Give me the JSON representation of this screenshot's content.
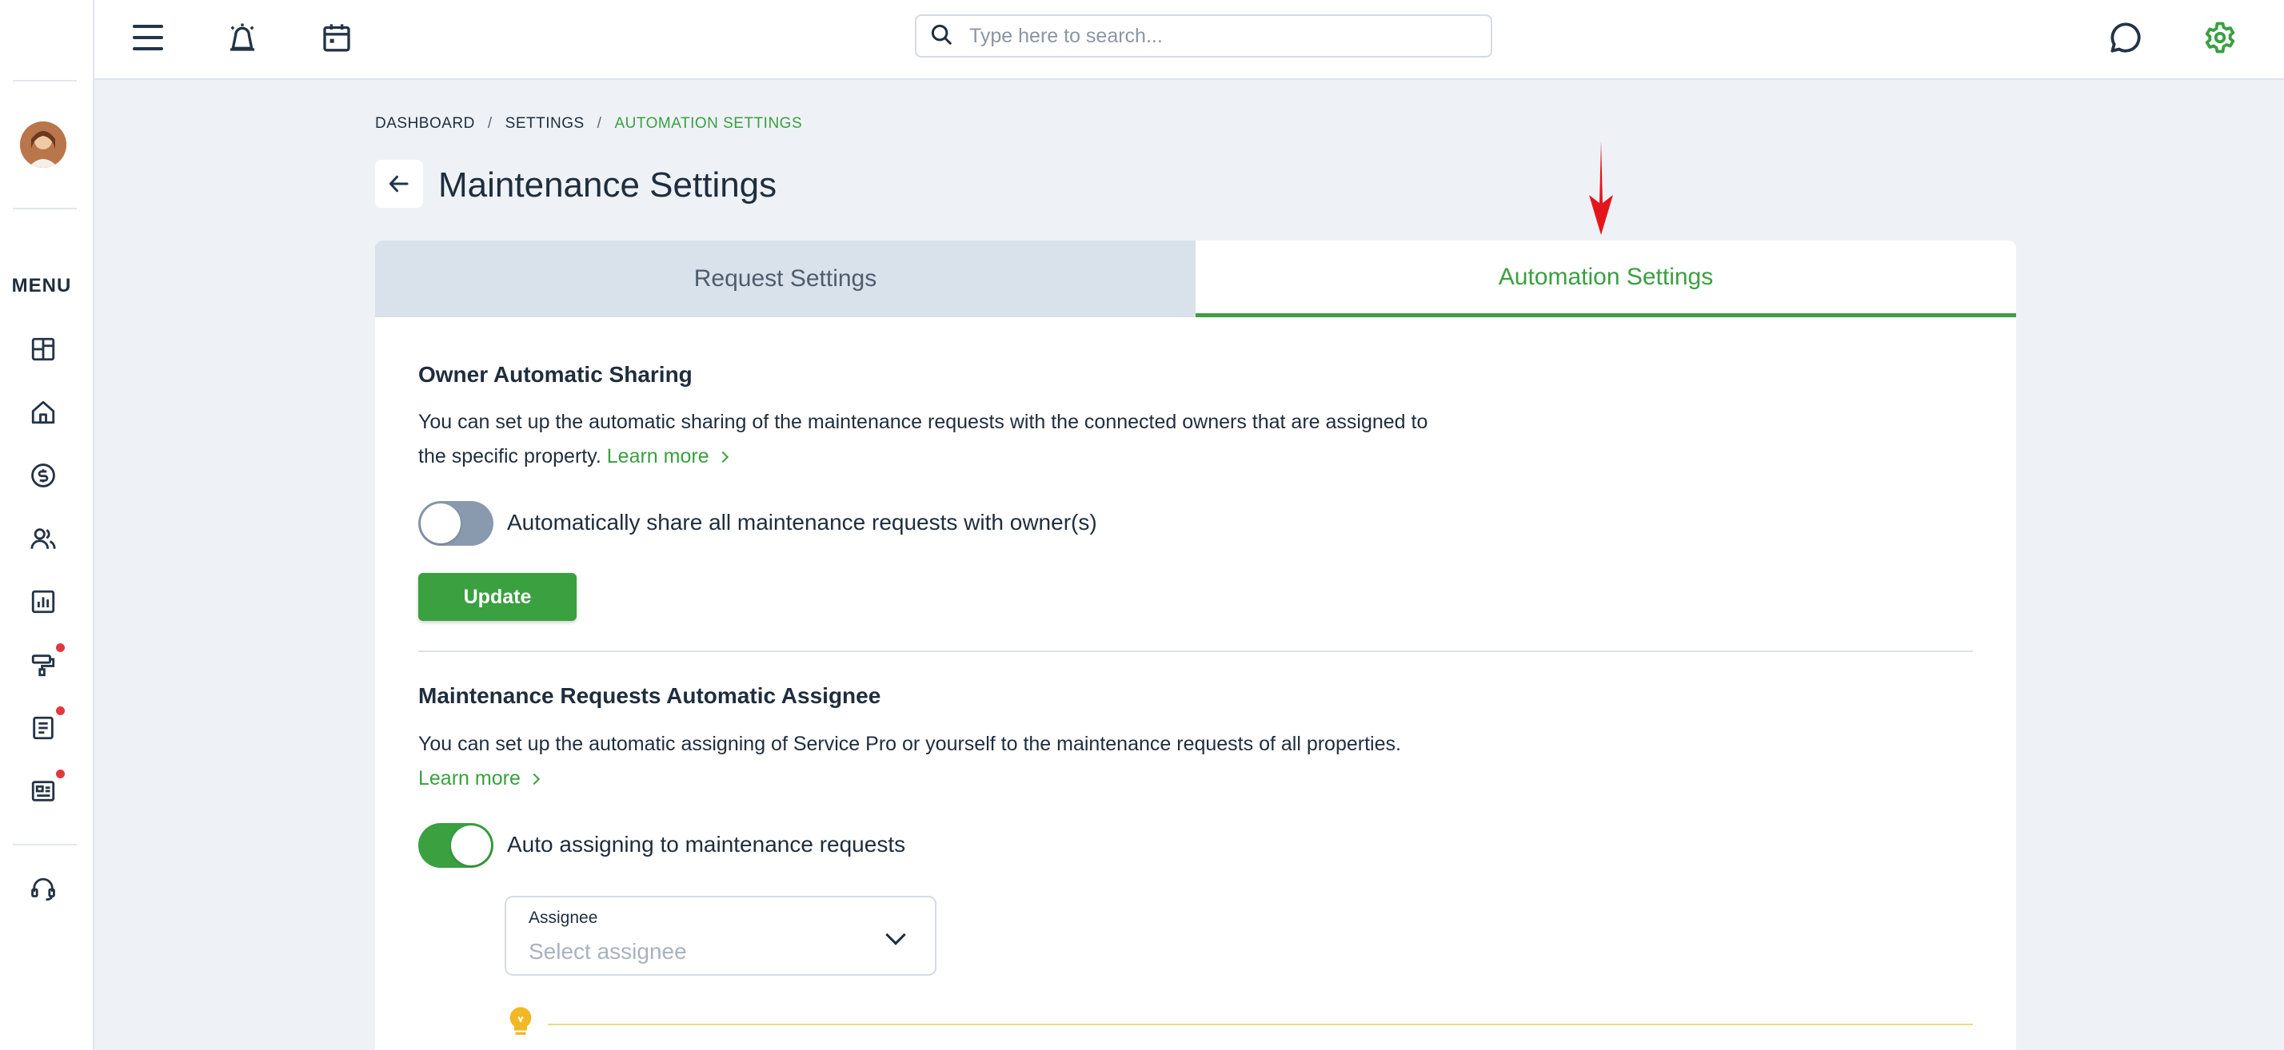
{
  "search": {
    "placeholder": "Type here to search..."
  },
  "sidebar": {
    "menu_label": "MENU",
    "items": [
      {
        "icon": "dashboard-icon",
        "badge": false
      },
      {
        "icon": "home-icon",
        "badge": false
      },
      {
        "icon": "dollar-icon",
        "badge": false
      },
      {
        "icon": "people-icon",
        "badge": false
      },
      {
        "icon": "reports-icon",
        "badge": false
      },
      {
        "icon": "maintenance-icon",
        "badge": true
      },
      {
        "icon": "document-icon",
        "badge": true
      },
      {
        "icon": "listing-icon",
        "badge": true
      },
      {
        "icon": "support-icon",
        "badge": false
      }
    ]
  },
  "breadcrumb": {
    "items": [
      "DASHBOARD",
      "SETTINGS"
    ],
    "current": "AUTOMATION SETTINGS",
    "separator": "/"
  },
  "page": {
    "title": "Maintenance Settings"
  },
  "tabs": [
    {
      "label": "Request Settings",
      "active": false
    },
    {
      "label": "Automation Settings",
      "active": true
    }
  ],
  "owner_sharing": {
    "title": "Owner Automatic Sharing",
    "desc_line1": "You can set up the automatic sharing of the maintenance requests with the connected owners that are assigned to",
    "desc_line2": "the specific property.",
    "learn_more": "Learn more",
    "toggle_label": "Automatically share all maintenance requests with owner(s)",
    "toggle_on": false,
    "update_label": "Update"
  },
  "auto_assignee": {
    "title": "Maintenance Requests Automatic Assignee",
    "desc": "You can set up the automatic assigning of Service Pro or yourself to the maintenance requests of all properties.",
    "learn_more": "Learn more",
    "toggle_label": "Auto assigning to maintenance requests",
    "toggle_on": true,
    "assignee_label": "Assignee",
    "assignee_placeholder": "Select assignee"
  },
  "colors": {
    "accent": "#3aa040",
    "badge": "#e0383e",
    "annotation_arrow": "#e4161b"
  }
}
